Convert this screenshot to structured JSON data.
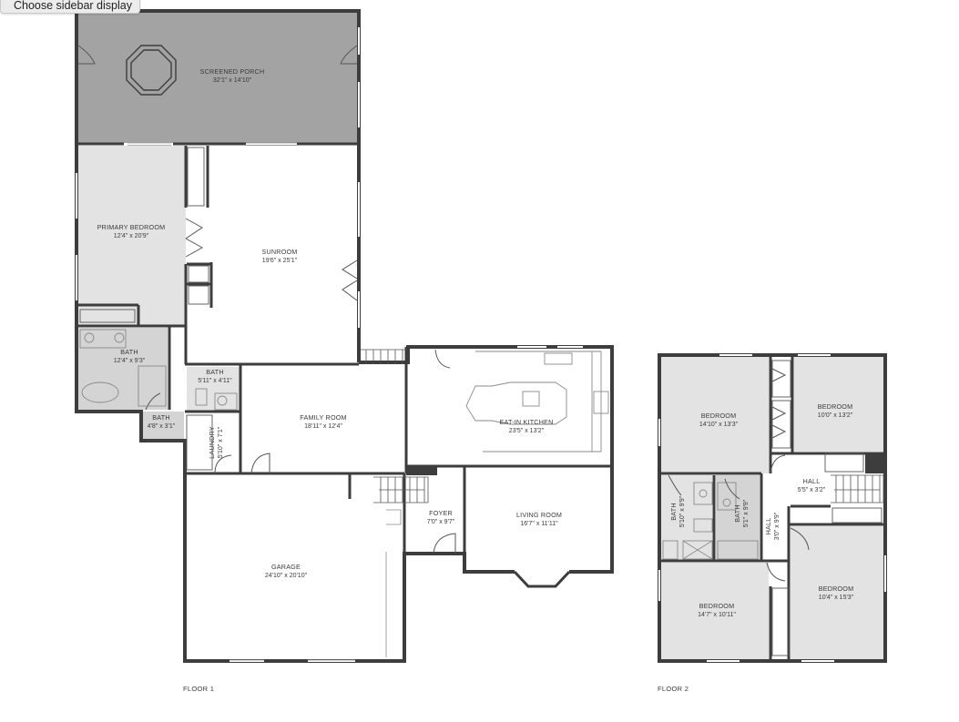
{
  "tooltip": {
    "label": "Choose sidebar display"
  },
  "floors": [
    {
      "caption": "FLOOR 1"
    },
    {
      "caption": "FLOOR 2"
    }
  ],
  "rooms": {
    "screened_porch": {
      "name": "SCREENED PORCH",
      "dim": "32'1\" x 14'10\""
    },
    "primary_bedroom": {
      "name": "PRIMARY BEDROOM",
      "dim": "12'4\" x 20'9\""
    },
    "sunroom": {
      "name": "SUNROOM",
      "dim": "19'6\" x 25'1\""
    },
    "bath_primary": {
      "name": "BATH",
      "dim": "12'4\" x 9'3\""
    },
    "bath_small": {
      "name": "BATH",
      "dim": "5'11\" x 4'11\""
    },
    "bath_half": {
      "name": "BATH",
      "dim": "4'8\" x 3'1\""
    },
    "laundry": {
      "name": "LAUNDRY",
      "dim": "5'10\" x 7'1\""
    },
    "family_room": {
      "name": "FAMILY ROOM",
      "dim": "18'11\" x 12'4\""
    },
    "kitchen": {
      "name": "EAT-IN KITCHEN",
      "dim": "23'5\" x 13'2\""
    },
    "foyer": {
      "name": "FOYER",
      "dim": "7'0\" x 9'7\""
    },
    "living_room": {
      "name": "LIVING ROOM",
      "dim": "16'7\" x 11'11\""
    },
    "garage": {
      "name": "GARAGE",
      "dim": "24'10\" x 20'10\""
    },
    "bedroom_a": {
      "name": "BEDROOM",
      "dim": "14'10\" x 13'3\""
    },
    "bedroom_b": {
      "name": "BEDROOM",
      "dim": "10'0\" x 13'2\""
    },
    "hall_2": {
      "name": "HALL",
      "dim": "5'5\" x 3'2\""
    },
    "bath_2a": {
      "name": "BATH",
      "dim": "5'10\" x 9'9\""
    },
    "bath_2b": {
      "name": "BATH",
      "dim": "5'1\" x 9'9\""
    },
    "hall_2v": {
      "name": "HALL",
      "dim": "3'0\" x 9'9\""
    },
    "bedroom_c": {
      "name": "BEDROOM",
      "dim": "14'7\" x 10'11\""
    },
    "bedroom_d": {
      "name": "BEDROOM",
      "dim": "10'4\" x 15'3\""
    }
  },
  "colors": {
    "wall": "#3d3d3d",
    "porch_fill": "#a3a3a3",
    "room_fill": "#e3e3e3",
    "bath_fill": "#d4d4d4",
    "fixture": "#8a8a8a"
  }
}
